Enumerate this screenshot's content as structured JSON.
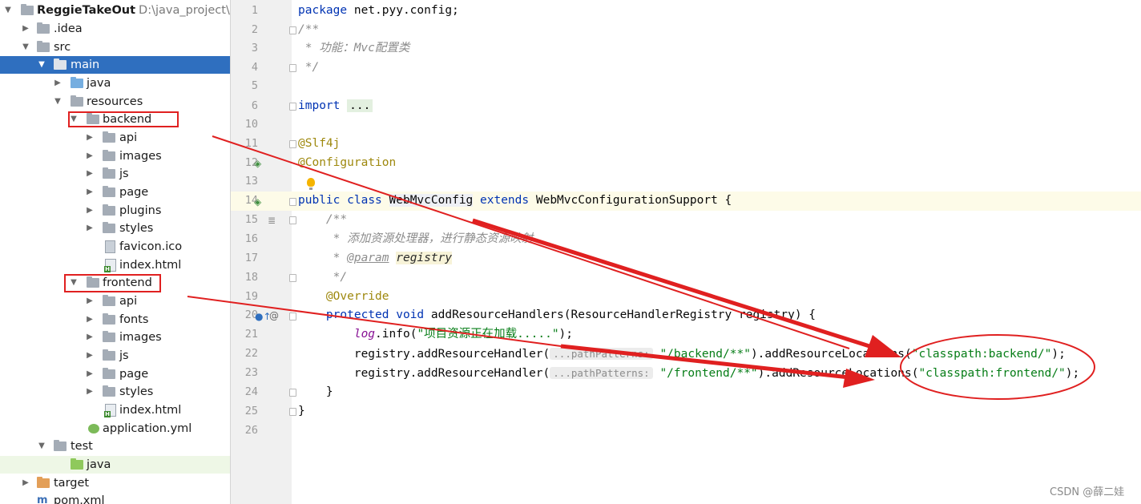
{
  "project_tree": {
    "root": {
      "name": "ReggieTakeOut",
      "path": "D:\\java_project\\Reg"
    },
    "idea": ".idea",
    "src": "src",
    "main": "main",
    "java": "java",
    "resources": "resources",
    "backend": {
      "name": "backend",
      "children": [
        "api",
        "images",
        "js",
        "page",
        "plugins",
        "styles"
      ],
      "favicon": "favicon.ico",
      "index": "index.html"
    },
    "frontend": {
      "name": "frontend",
      "children": [
        "api",
        "fonts",
        "images",
        "js",
        "page",
        "styles"
      ],
      "index": "index.html"
    },
    "application": "application.yml",
    "test": "test",
    "test_java": "java",
    "target": "target",
    "pom": "pom.xml"
  },
  "editor": {
    "line_numbers": [
      "1",
      "2",
      "3",
      "4",
      "5",
      "6",
      "10",
      "11",
      "12",
      "13",
      "14",
      "15",
      "16",
      "17",
      "18",
      "19",
      "20",
      "21",
      "22",
      "23",
      "24",
      "25",
      "26"
    ],
    "l1_kw": "package",
    "l1_rest": " net.pyy.config;",
    "l2": "/**",
    "l3": " * 功能：Mvc配置类",
    "l4": " */",
    "l6_kw": "import",
    "l6_fold": "...",
    "l11": "@Slf4j",
    "l12": "@Configuration",
    "l14_public": "public",
    "l14_class": "class",
    "l14_name": "WebMvcConfig",
    "l14_extends": "extends",
    "l14_rest": " WebMvcConfigurationSupport {",
    "l15": "    /**",
    "l16": "     * 添加资源处理器，进行静态资源映射",
    "l17_star": "     * ",
    "l17_tag": "@param",
    "l17_name": "registry",
    "l18": "     */",
    "l19": "    @Override",
    "l20_protected": "protected",
    "l20_void": "void",
    "l20_rest": " addResourceHandlers(ResourceHandlerRegistry registry) {",
    "l21_indent": "        ",
    "l21_log": "log",
    "l21_mid": ".info(",
    "l21_str": "\"项目资源正在加载.....\"",
    "l21_end": ");",
    "l22_a": "        registry.addResourceHandler(",
    "l22_hint": "...pathPatterns:",
    "l22_str1": "\"/backend/**\"",
    "l22_b": ").addResourceLocations(",
    "l22_str2": "\"classpath:backend/\"",
    "l22_end": ");",
    "l23_a": "        registry.addResourceHandler(",
    "l23_hint": "...pathPatterns:",
    "l23_str1": "\"/frontend/**\"",
    "l23_b": ").addResourceLocations(",
    "l23_str2": "\"classpath:frontend/\"",
    "l23_end": ");",
    "l24": "    }",
    "l25": "}"
  },
  "watermark": "CSDN @薛二娃",
  "colors": {
    "selection": "#2f6fbf",
    "annotation_red": "#e02020",
    "keyword": "#0033b3",
    "string": "#067d17"
  }
}
